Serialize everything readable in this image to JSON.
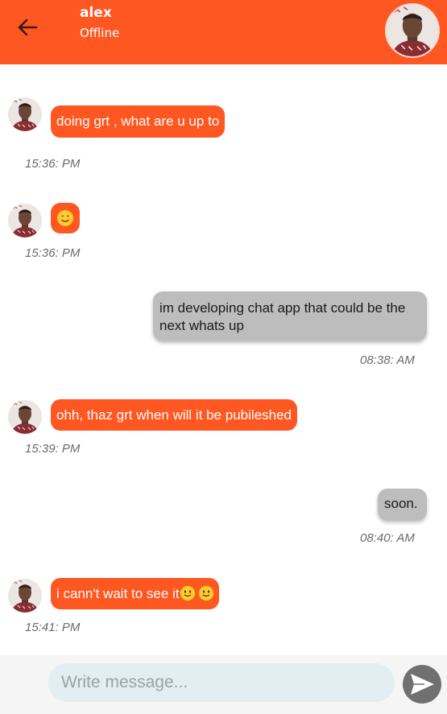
{
  "header": {
    "contact_name": "alex",
    "status": "Offline",
    "back_icon": "arrow-left-icon"
  },
  "messages": [
    {
      "direction": "incoming",
      "text": "doing grt , what are u up to",
      "time": "15:36: PM"
    },
    {
      "direction": "incoming",
      "text": "",
      "emoji": "smiling-face-icon",
      "time": "15:36: PM"
    },
    {
      "direction": "outgoing",
      "text": "im developing chat app that could be the next whats up",
      "time": "08:38: AM"
    },
    {
      "direction": "incoming",
      "text": "ohh, thaz grt when will it be pubileshed",
      "time": "15:39: PM"
    },
    {
      "direction": "outgoing",
      "text": "soon.",
      "time": "08:40: AM"
    },
    {
      "direction": "incoming",
      "text": "i cann't wait to see it",
      "emoji": "slightly-smiling-face-icon",
      "time": "15:41: PM"
    }
  ],
  "composer": {
    "placeholder": "Write message...",
    "send_icon": "send-icon"
  },
  "colors": {
    "accent": "#ff5722",
    "outgoing_bubble": "#bdbdbd",
    "send_button": "#707070",
    "input_bg": "#e3eef2"
  }
}
